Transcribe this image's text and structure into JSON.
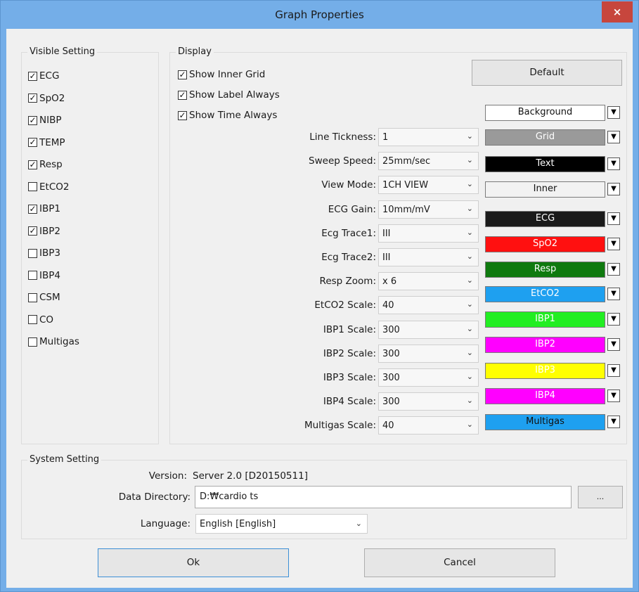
{
  "window": {
    "title": "Graph Properties",
    "close_label": "×"
  },
  "visible_setting": {
    "legend": "Visible Setting",
    "items": [
      {
        "label": "ECG",
        "checked": true
      },
      {
        "label": "SpO2",
        "checked": true
      },
      {
        "label": "NIBP",
        "checked": true
      },
      {
        "label": "TEMP",
        "checked": true
      },
      {
        "label": "Resp",
        "checked": true
      },
      {
        "label": "EtCO2",
        "checked": false
      },
      {
        "label": "IBP1",
        "checked": true
      },
      {
        "label": "IBP2",
        "checked": true
      },
      {
        "label": "IBP3",
        "checked": false
      },
      {
        "label": "IBP4",
        "checked": false
      },
      {
        "label": "CSM",
        "checked": false
      },
      {
        "label": "CO",
        "checked": false
      },
      {
        "label": "Multigas",
        "checked": false
      }
    ]
  },
  "display": {
    "legend": "Display",
    "options": [
      {
        "label": "Show Inner Grid",
        "checked": true
      },
      {
        "label": "Show Label Always",
        "checked": true
      },
      {
        "label": "Show Time Always",
        "checked": true
      }
    ],
    "default_button": "Default",
    "fields": [
      {
        "label": "Line Tickness:",
        "value": "1"
      },
      {
        "label": "Sweep Speed:",
        "value": "25mm/sec"
      },
      {
        "label": "View Mode:",
        "value": "1CH VIEW"
      },
      {
        "label": "ECG Gain:",
        "value": "10mm/mV"
      },
      {
        "label": "Ecg Trace1:",
        "value": "III"
      },
      {
        "label": "Ecg Trace2:",
        "value": "III"
      },
      {
        "label": "Resp Zoom:",
        "value": "x 6"
      },
      {
        "label": "EtCO2 Scale:",
        "value": "40"
      },
      {
        "label": "IBP1 Scale:",
        "value": "300"
      },
      {
        "label": "IBP2 Scale:",
        "value": "300"
      },
      {
        "label": "IBP3 Scale:",
        "value": "300"
      },
      {
        "label": "IBP4 Scale:",
        "value": "300"
      },
      {
        "label": "Multigas Scale:",
        "value": "40"
      }
    ],
    "colors": [
      {
        "label": "Background",
        "bg": "#ffffff",
        "fg": "#111111"
      },
      {
        "label": "Grid",
        "bg": "#9a9a9a",
        "fg": "#ffffff"
      },
      {
        "label": "Text",
        "bg": "#000000",
        "fg": "#ffffff"
      },
      {
        "label": "Inner",
        "bg": "#f2f2f2",
        "fg": "#111111"
      },
      {
        "label": "ECG",
        "bg": "#1a1a1a",
        "fg": "#ffffff"
      },
      {
        "label": "SpO2",
        "bg": "#ff1010",
        "fg": "#ffffff"
      },
      {
        "label": "Resp",
        "bg": "#0f7a0f",
        "fg": "#ffffff"
      },
      {
        "label": "EtCO2",
        "bg": "#1ea0f0",
        "fg": "#ffffff"
      },
      {
        "label": "IBP1",
        "bg": "#22ee22",
        "fg": "#ffffff"
      },
      {
        "label": "IBP2",
        "bg": "#ff00ff",
        "fg": "#ffffff"
      },
      {
        "label": "IBP3",
        "bg": "#ffff00",
        "fg": "#ffffff"
      },
      {
        "label": "IBP4",
        "bg": "#ff00ff",
        "fg": "#ffffff"
      },
      {
        "label": "Multigas",
        "bg": "#1ea0f0",
        "fg": "#111111"
      }
    ],
    "color_dropdown_icon": "triangle-down"
  },
  "system": {
    "legend": "System Setting",
    "version_label": "Version:",
    "version_value": "Server 2.0 [D20150511]",
    "data_dir_label": "Data Directory:",
    "data_dir_value": "D:₩cardio ts",
    "browse_label": "...",
    "language_label": "Language:",
    "language_value": "English [English]"
  },
  "footer": {
    "ok_label": "Ok",
    "cancel_label": "Cancel"
  }
}
